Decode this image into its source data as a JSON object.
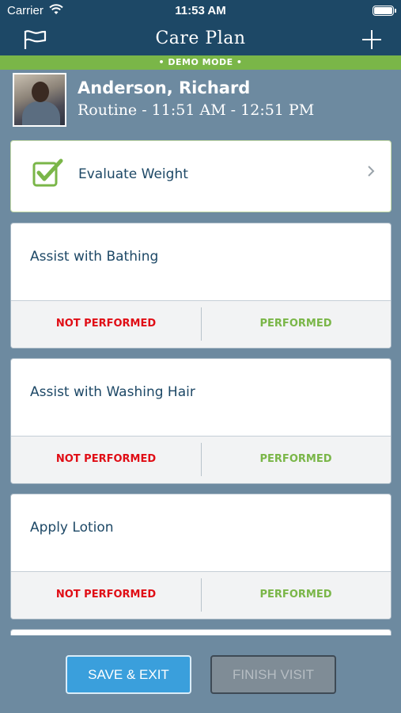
{
  "status": {
    "carrier": "Carrier",
    "time": "11:53 AM"
  },
  "nav": {
    "title": "Care Plan"
  },
  "demo": {
    "label": "• DEMO MODE •"
  },
  "patient": {
    "name": "Anderson, Richard",
    "visit": "Routine - 11:51 AM - 12:51 PM"
  },
  "tasks": [
    {
      "title": "Evaluate Weight",
      "completed": true
    },
    {
      "title": "Assist with Bathing",
      "not_performed": "NOT PERFORMED",
      "performed": "PERFORMED"
    },
    {
      "title": "Assist with Washing Hair",
      "not_performed": "NOT PERFORMED",
      "performed": "PERFORMED"
    },
    {
      "title": "Apply Lotion",
      "not_performed": "NOT PERFORMED",
      "performed": "PERFORMED"
    }
  ],
  "footer": {
    "save_label": "SAVE & EXIT",
    "finish_label": "FINISH VISIT"
  },
  "colors": {
    "nav": "#1d4866",
    "accent_green": "#7ab648",
    "alert_red": "#e00d15",
    "save_blue": "#3a9fdc"
  },
  "icons": [
    "wifi-icon",
    "battery-icon",
    "flag-icon",
    "plus-icon",
    "checkbox-checked-icon",
    "chevron-right-icon"
  ]
}
